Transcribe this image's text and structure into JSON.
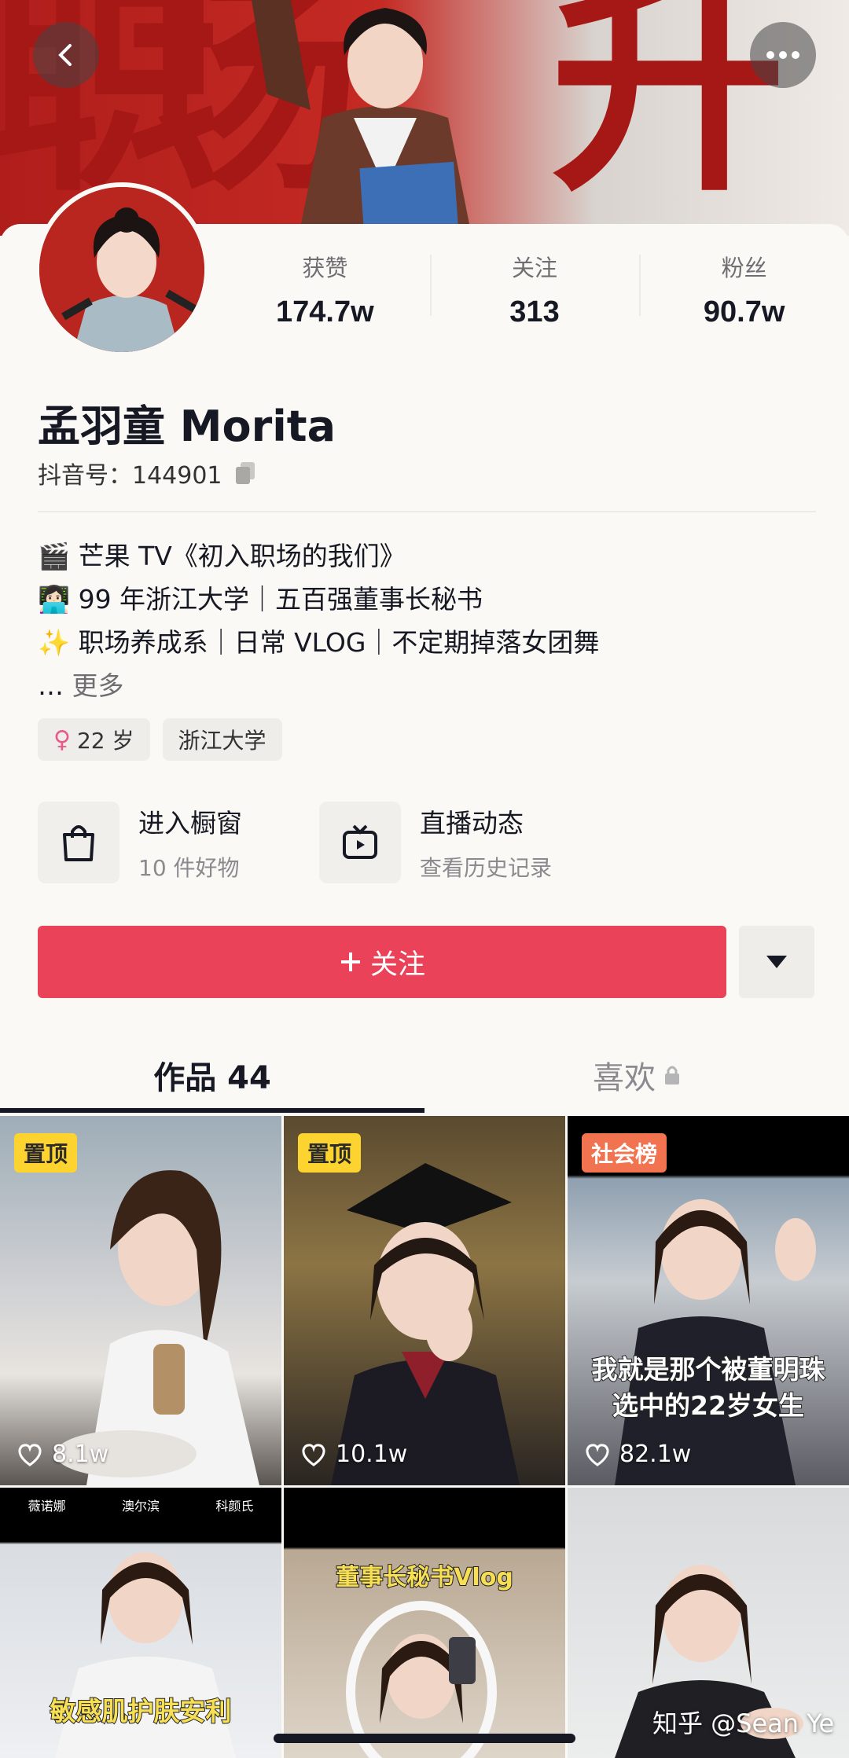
{
  "stats": [
    {
      "label": "获赞",
      "value": "174.7w"
    },
    {
      "label": "关注",
      "value": "313"
    },
    {
      "label": "粉丝",
      "value": "90.7w"
    }
  ],
  "profile": {
    "name": "孟羽童 Morita",
    "douyin_id": "抖音号：144901"
  },
  "bio": {
    "line1": "🎬 芒果 TV《初入职场的我们》",
    "line2": "👩🏻‍💻 99 年浙江大学｜五百强董事长秘书",
    "line3": "✨ 职场养成系｜日常 VLOG｜不定期掉落女团舞",
    "more": "更多"
  },
  "tags": {
    "age": "22 岁",
    "school": "浙江大学"
  },
  "entries": [
    {
      "title": "进入橱窗",
      "sub": "10 件好物"
    },
    {
      "title": "直播动态",
      "sub": "查看历史记录"
    }
  ],
  "follow_label": "关注",
  "tabs": {
    "works": "作品 44",
    "likes": "喜欢"
  },
  "videos": [
    {
      "badge": "置顶",
      "likes": "8.1w"
    },
    {
      "badge": "置顶",
      "likes": "10.1w"
    },
    {
      "badge": "社会榜",
      "likes": "82.1w",
      "caption1": "我就是那个被董明珠",
      "caption2": "选中的22岁女生"
    },
    {
      "caption": "敏感肌护肤安利",
      "topnote": [
        "薇诺娜",
        "澳尔滨",
        "科颜氏"
      ]
    },
    {
      "caption": "董事长秘书Vlog"
    },
    {}
  ],
  "watermark": "知乎 @Sean Ye",
  "colors": {
    "follow": "#ea4359",
    "pin_badge": "#fcd32f",
    "hot_badge": "#f2734f"
  }
}
